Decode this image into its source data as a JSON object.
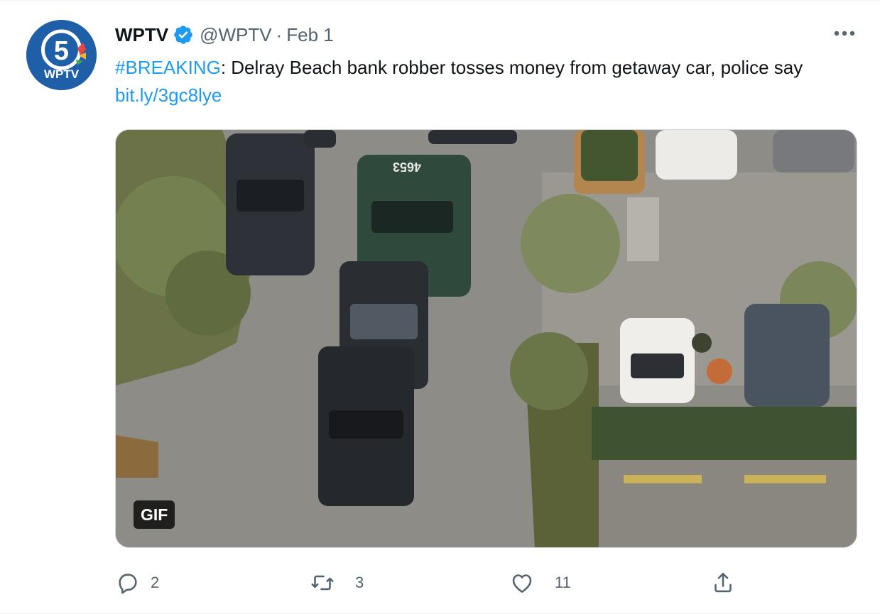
{
  "tweet": {
    "author_name": "WPTV",
    "handle": "@WPTV",
    "separator": "·",
    "date": "Feb 1",
    "avatar_text": "WPTV",
    "avatar_number": "5",
    "text_hashtag": "#BREAKING",
    "text_body": ": Delray Beach bank robber tosses money from getaway car, police say ",
    "text_link": "bit.ly/3gc8lye",
    "media_badge": "GIF",
    "roof_number": "4653"
  },
  "actions": {
    "reply_count": "2",
    "retweet_count": "3",
    "like_count": "11"
  },
  "colors": {
    "link": "#1d9bf0",
    "secondary_text": "#536471",
    "verified": "#1d9bf0"
  },
  "icons": [
    "verified-badge-icon",
    "more-icon",
    "reply-icon",
    "retweet-icon",
    "like-icon",
    "share-icon"
  ]
}
